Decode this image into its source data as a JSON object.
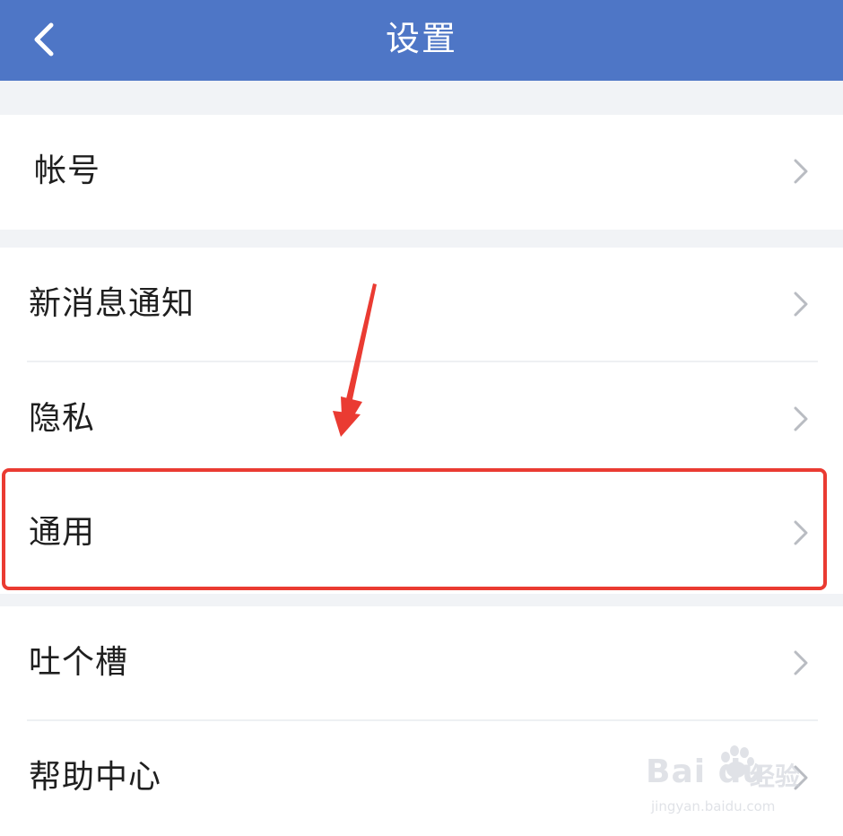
{
  "header": {
    "title": "设置"
  },
  "settings": {
    "groups": [
      {
        "items": [
          {
            "label": "帐号"
          }
        ]
      },
      {
        "items": [
          {
            "label": "新消息通知"
          },
          {
            "label": "隐私"
          },
          {
            "label": "通用"
          }
        ]
      },
      {
        "items": [
          {
            "label": "吐个槽"
          },
          {
            "label": "帮助中心"
          }
        ]
      }
    ]
  },
  "icons": {
    "back": "chevron-left-icon",
    "row_arrow": "chevron-right-icon",
    "annotation_arrow": "arrow-down-icon"
  },
  "colors": {
    "header_bg": "#4e76c6",
    "header_text": "#ffffff",
    "page_bg": "#f1f3f6",
    "row_bg": "#ffffff",
    "highlight": "#ea3b32",
    "chevron": "#b9bcc2"
  },
  "watermark": {
    "logo": "Bai du",
    "logo_cn": "经验",
    "url": "jingyan.baidu.com"
  }
}
